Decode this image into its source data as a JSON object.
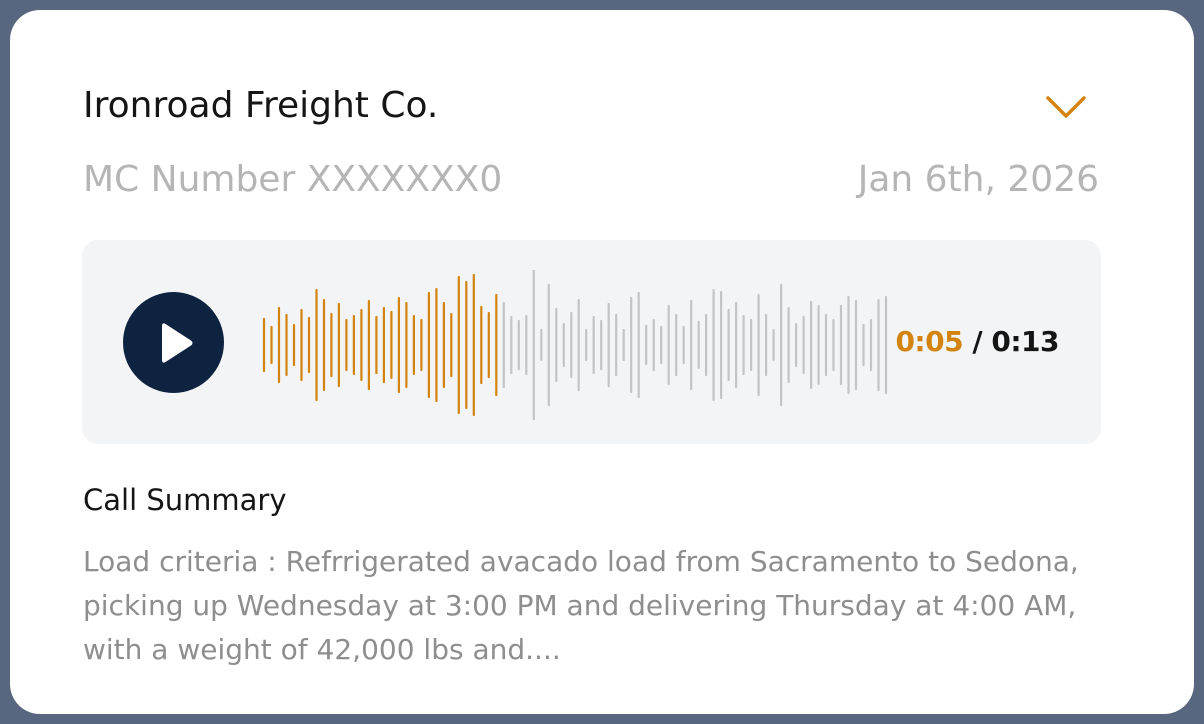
{
  "header": {
    "company": "Ironroad Freight Co.",
    "mc_number": "MC Number XXXXXXX0",
    "date": "Jan 6th, 2026",
    "expand_icon": "chevron-down-icon"
  },
  "player": {
    "play_icon": "play-icon",
    "current_time": "0:05",
    "separator": " / ",
    "total_time": "0:13",
    "progress": 0.385,
    "played_color": "#d3830f",
    "unplayed_color": "#c4c4c4",
    "button_color": "#0e2340"
  },
  "summary": {
    "title": "Call Summary",
    "text": "Load criteria : Refrrigerated avacado load from Sacramento to Sedona, picking up Wednesday at 3:00 PM and delivering Thursday at 4:00 AM, with a weight of 42,000 lbs and...."
  },
  "colors": {
    "frame": "#58677f",
    "accent": "#d3830f"
  }
}
